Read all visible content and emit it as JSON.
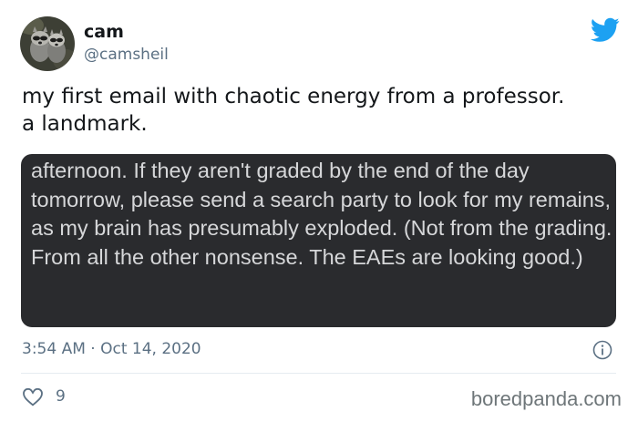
{
  "user": {
    "display_name": "cam",
    "handle": "@camsheil",
    "avatar_icon": "raccoon-avatar"
  },
  "tweet": {
    "text": "my first email with chaotic energy from a professor. a landmark.",
    "media_text": "afternoon. If they aren't graded by the end of the day tomorrow, please send a search party to look for my remains, as my brain has presumably exploded. (Not from the grading. From all the other nonsense. The EAEs are looking good.)",
    "timestamp": "3:54 AM · Oct 14, 2020",
    "likes": "9"
  },
  "brand": {
    "icon": "twitter-bird-icon",
    "color": "#1da1f2"
  },
  "watermark": "boredpanda.com"
}
